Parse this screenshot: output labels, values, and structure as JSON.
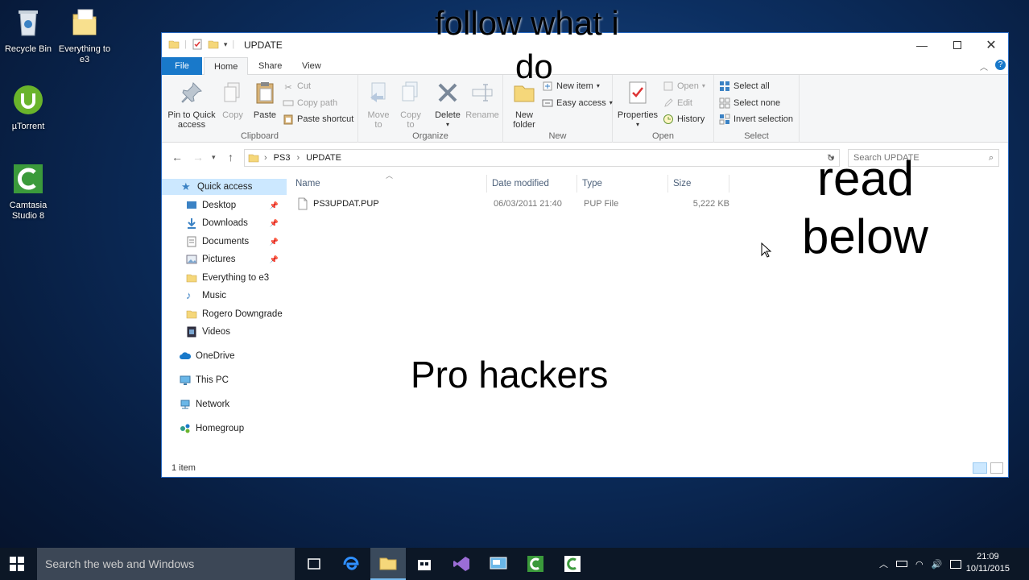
{
  "desktop": {
    "icons": [
      {
        "label": "Recycle Bin"
      },
      {
        "label": "Everything to e3"
      },
      {
        "label": "µTorrent"
      },
      {
        "label": "Camtasia Studio 8"
      }
    ]
  },
  "window": {
    "title": "UPDATE",
    "tabs": [
      "File",
      "Home",
      "Share",
      "View"
    ],
    "ribbon": {
      "clipboard": {
        "label": "Clipboard",
        "pin": "Pin to Quick access",
        "copy": "Copy",
        "paste": "Paste",
        "cut": "Cut",
        "copy_path": "Copy path",
        "paste_shortcut": "Paste shortcut"
      },
      "organize": {
        "label": "Organize",
        "move_to": "Move to",
        "copy_to": "Copy to",
        "delete": "Delete",
        "rename": "Rename"
      },
      "new": {
        "label": "New",
        "new_folder": "New folder",
        "new_item": "New item",
        "easy_access": "Easy access"
      },
      "open": {
        "label": "Open",
        "properties": "Properties",
        "open": "Open",
        "edit": "Edit",
        "history": "History"
      },
      "select": {
        "label": "Select",
        "select_all": "Select all",
        "select_none": "Select none",
        "invert": "Invert selection"
      }
    },
    "address": {
      "crumbs": [
        "PS3",
        "UPDATE"
      ],
      "search_placeholder": "Search UPDATE"
    },
    "nav": {
      "quick_access": "Quick access",
      "items": [
        "Desktop",
        "Downloads",
        "Documents",
        "Pictures",
        "Everything to e3",
        "Music",
        "Rogero Downgrade",
        "Videos"
      ],
      "onedrive": "OneDrive",
      "this_pc": "This PC",
      "network": "Network",
      "homegroup": "Homegroup"
    },
    "columns": [
      "Name",
      "Date modified",
      "Type",
      "Size"
    ],
    "files": [
      {
        "name": "PS3UPDAT.PUP",
        "date": "06/03/2011 21:40",
        "type": "PUP File",
        "size": "5,222 KB"
      }
    ],
    "status": "1 item"
  },
  "overlays": {
    "top_line1": "follow what i",
    "top_line2": "do",
    "right_line1": "read",
    "right_line2": "below",
    "center": "Pro hackers"
  },
  "taskbar": {
    "search_placeholder": "Search the web and Windows",
    "time": "21:09",
    "date": "10/11/2015"
  }
}
